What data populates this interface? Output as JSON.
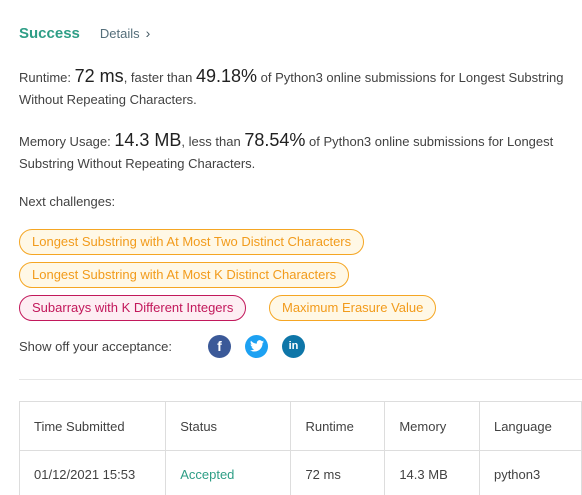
{
  "header": {
    "status": "Success",
    "details_label": "Details",
    "details_chevron": "›"
  },
  "runtime": {
    "label": "Runtime:",
    "value": "72 ms",
    "comparison": ", faster than",
    "percent": "49.18%",
    "suffix": "of Python3 online submissions for Longest Substring Without Repeating Characters."
  },
  "memory": {
    "label": "Memory Usage:",
    "value": "14.3 MB",
    "comparison": ", less than",
    "percent": "78.54%",
    "suffix": "of Python3 online submissions for Longest Substring Without Repeating Characters."
  },
  "next_challenges": {
    "label": "Next challenges:",
    "items": [
      {
        "label": "Longest Substring with At Most Two Distinct Characters",
        "difficulty": "medium"
      },
      {
        "label": "Longest Substring with At Most K Distinct Characters",
        "difficulty": "medium"
      },
      {
        "label": "Subarrays with K Different Integers",
        "difficulty": "hard"
      },
      {
        "label": "Maximum Erasure Value",
        "difficulty": "medium"
      }
    ]
  },
  "share": {
    "label": "Show off your acceptance:",
    "icons": [
      {
        "name": "facebook-icon",
        "glyph": "f",
        "color": "#3b5998"
      },
      {
        "name": "twitter-icon",
        "glyph": "bird",
        "color": "#1da1f2"
      },
      {
        "name": "linkedin-icon",
        "glyph": "in",
        "color": "#0e76a8"
      }
    ]
  },
  "submissions": {
    "columns": [
      "Time Submitted",
      "Status",
      "Runtime",
      "Memory",
      "Language"
    ],
    "rows": [
      {
        "time": "01/12/2021 15:53",
        "status": "Accepted",
        "runtime": "72 ms",
        "memory": "14.3 MB",
        "language": "python3"
      }
    ]
  },
  "colors": {
    "success": "#2e9e86",
    "medium": "#f29b1b",
    "hard": "#c2185b"
  }
}
